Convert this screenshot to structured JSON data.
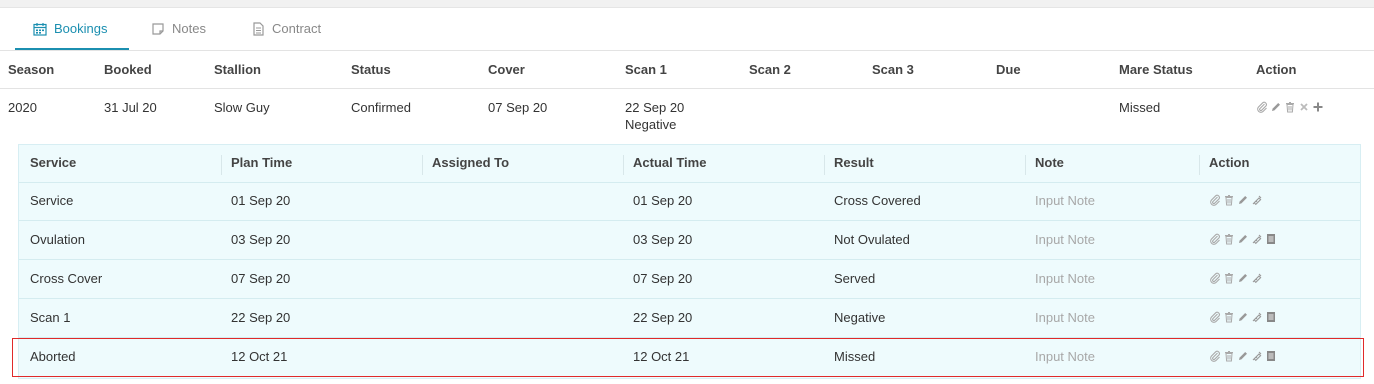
{
  "tabs": [
    {
      "label": "Bookings",
      "icon": "calendar-icon",
      "active": true
    },
    {
      "label": "Notes",
      "icon": "note-icon",
      "active": false
    },
    {
      "label": "Contract",
      "icon": "document-icon",
      "active": false
    }
  ],
  "bookings": {
    "headers": [
      "Season",
      "Booked",
      "Stallion",
      "Status",
      "Cover",
      "Scan 1",
      "Scan 2",
      "Scan 3",
      "Due",
      "Mare Status",
      "Action"
    ],
    "row": {
      "season": "2020",
      "booked": "31 Jul 20",
      "stallion": "Slow Guy",
      "status": "Confirmed",
      "cover": "07 Sep 20",
      "scan1": "22 Sep 20",
      "scan1_result": "Negative",
      "scan2": "",
      "scan3": "",
      "due": "",
      "mare_status": "Missed",
      "actions": [
        "attach-icon",
        "edit-icon",
        "delete-icon",
        "close-icon",
        "add-icon"
      ]
    }
  },
  "services": {
    "headers": [
      "Service",
      "Plan Time",
      "Assigned To",
      "Actual Time",
      "Result",
      "Note",
      "Action"
    ],
    "rows": [
      {
        "service": "Service",
        "plan_time": "01 Sep 20",
        "assigned_to": "",
        "actual_time": "01 Sep 20",
        "result": "Cross Covered",
        "note_placeholder": "Input Note",
        "actions": [
          "attach-icon",
          "delete-icon",
          "edit-icon",
          "syringe-icon"
        ]
      },
      {
        "service": "Ovulation",
        "plan_time": "03 Sep 20",
        "assigned_to": "",
        "actual_time": "03 Sep 20",
        "result": "Not Ovulated",
        "note_placeholder": "Input Note",
        "actions": [
          "attach-icon",
          "delete-icon",
          "edit-icon",
          "syringe-icon",
          "report-icon"
        ]
      },
      {
        "service": "Cross Cover",
        "plan_time": "07 Sep 20",
        "assigned_to": "",
        "actual_time": "07 Sep 20",
        "result": "Served",
        "note_placeholder": "Input Note",
        "actions": [
          "attach-icon",
          "delete-icon",
          "edit-icon",
          "syringe-icon"
        ]
      },
      {
        "service": "Scan 1",
        "plan_time": "22 Sep 20",
        "assigned_to": "",
        "actual_time": "22 Sep 20",
        "result": "Negative",
        "note_placeholder": "Input Note",
        "actions": [
          "attach-icon",
          "delete-icon",
          "edit-icon",
          "syringe-icon",
          "report-icon"
        ]
      },
      {
        "service": "Aborted",
        "plan_time": "12 Oct 21",
        "assigned_to": "",
        "actual_time": "12 Oct 21",
        "result": "Missed",
        "note_placeholder": "Input Note",
        "actions": [
          "attach-icon",
          "delete-icon",
          "edit-icon",
          "syringe-icon",
          "report-icon"
        ]
      }
    ]
  },
  "colors": {
    "accent": "#1b8fb0",
    "confirmed": "#3aa03a",
    "negative": "#e8b400",
    "subtable_bg": "#eefbfd",
    "highlight": "#e02a2a"
  }
}
